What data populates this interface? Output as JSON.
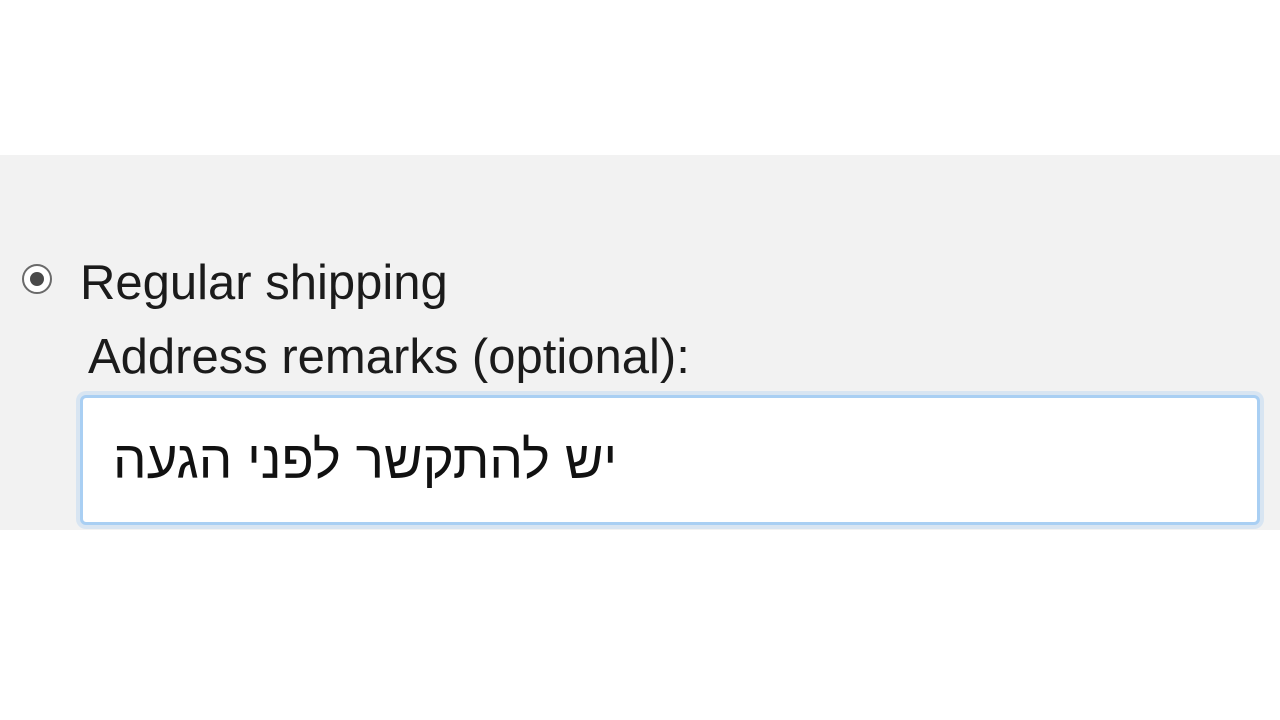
{
  "shipping": {
    "radio_label": "Regular shipping",
    "remarks_label": "Address remarks (optional):",
    "remarks_value": "יש להתקשר לפני הגעה"
  }
}
